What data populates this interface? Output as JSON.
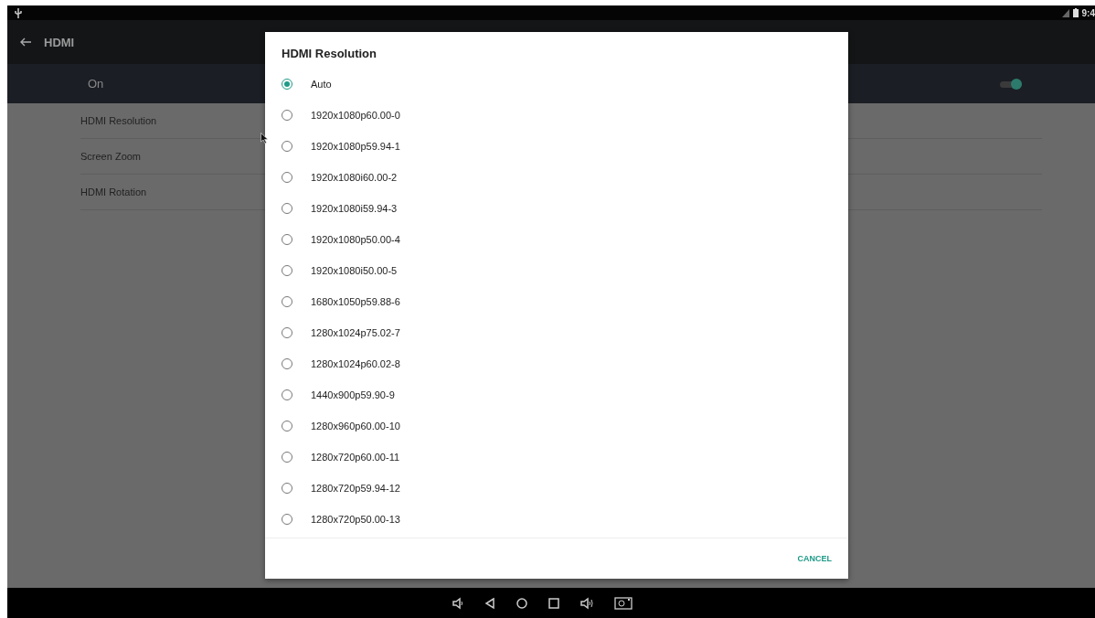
{
  "status_bar": {
    "time": "9:4"
  },
  "toolbar": {
    "title": "HDMI"
  },
  "master_switch": {
    "label": "On",
    "on": true
  },
  "settings": [
    {
      "label": "HDMI Resolution"
    },
    {
      "label": "Screen Zoom"
    },
    {
      "label": "HDMI Rotation"
    }
  ],
  "dialog": {
    "title": "HDMI Resolution",
    "options": [
      {
        "label": "Auto",
        "selected": true
      },
      {
        "label": "1920x1080p60.00-0",
        "selected": false
      },
      {
        "label": "1920x1080p59.94-1",
        "selected": false
      },
      {
        "label": "1920x1080i60.00-2",
        "selected": false
      },
      {
        "label": "1920x1080i59.94-3",
        "selected": false
      },
      {
        "label": "1920x1080p50.00-4",
        "selected": false
      },
      {
        "label": "1920x1080i50.00-5",
        "selected": false
      },
      {
        "label": "1680x1050p59.88-6",
        "selected": false
      },
      {
        "label": "1280x1024p75.02-7",
        "selected": false
      },
      {
        "label": "1280x1024p60.02-8",
        "selected": false
      },
      {
        "label": "1440x900p59.90-9",
        "selected": false
      },
      {
        "label": "1280x960p60.00-10",
        "selected": false
      },
      {
        "label": "1280x720p60.00-11",
        "selected": false
      },
      {
        "label": "1280x720p59.94-12",
        "selected": false
      },
      {
        "label": "1280x720p50.00-13",
        "selected": false
      }
    ],
    "button": "CANCEL"
  }
}
